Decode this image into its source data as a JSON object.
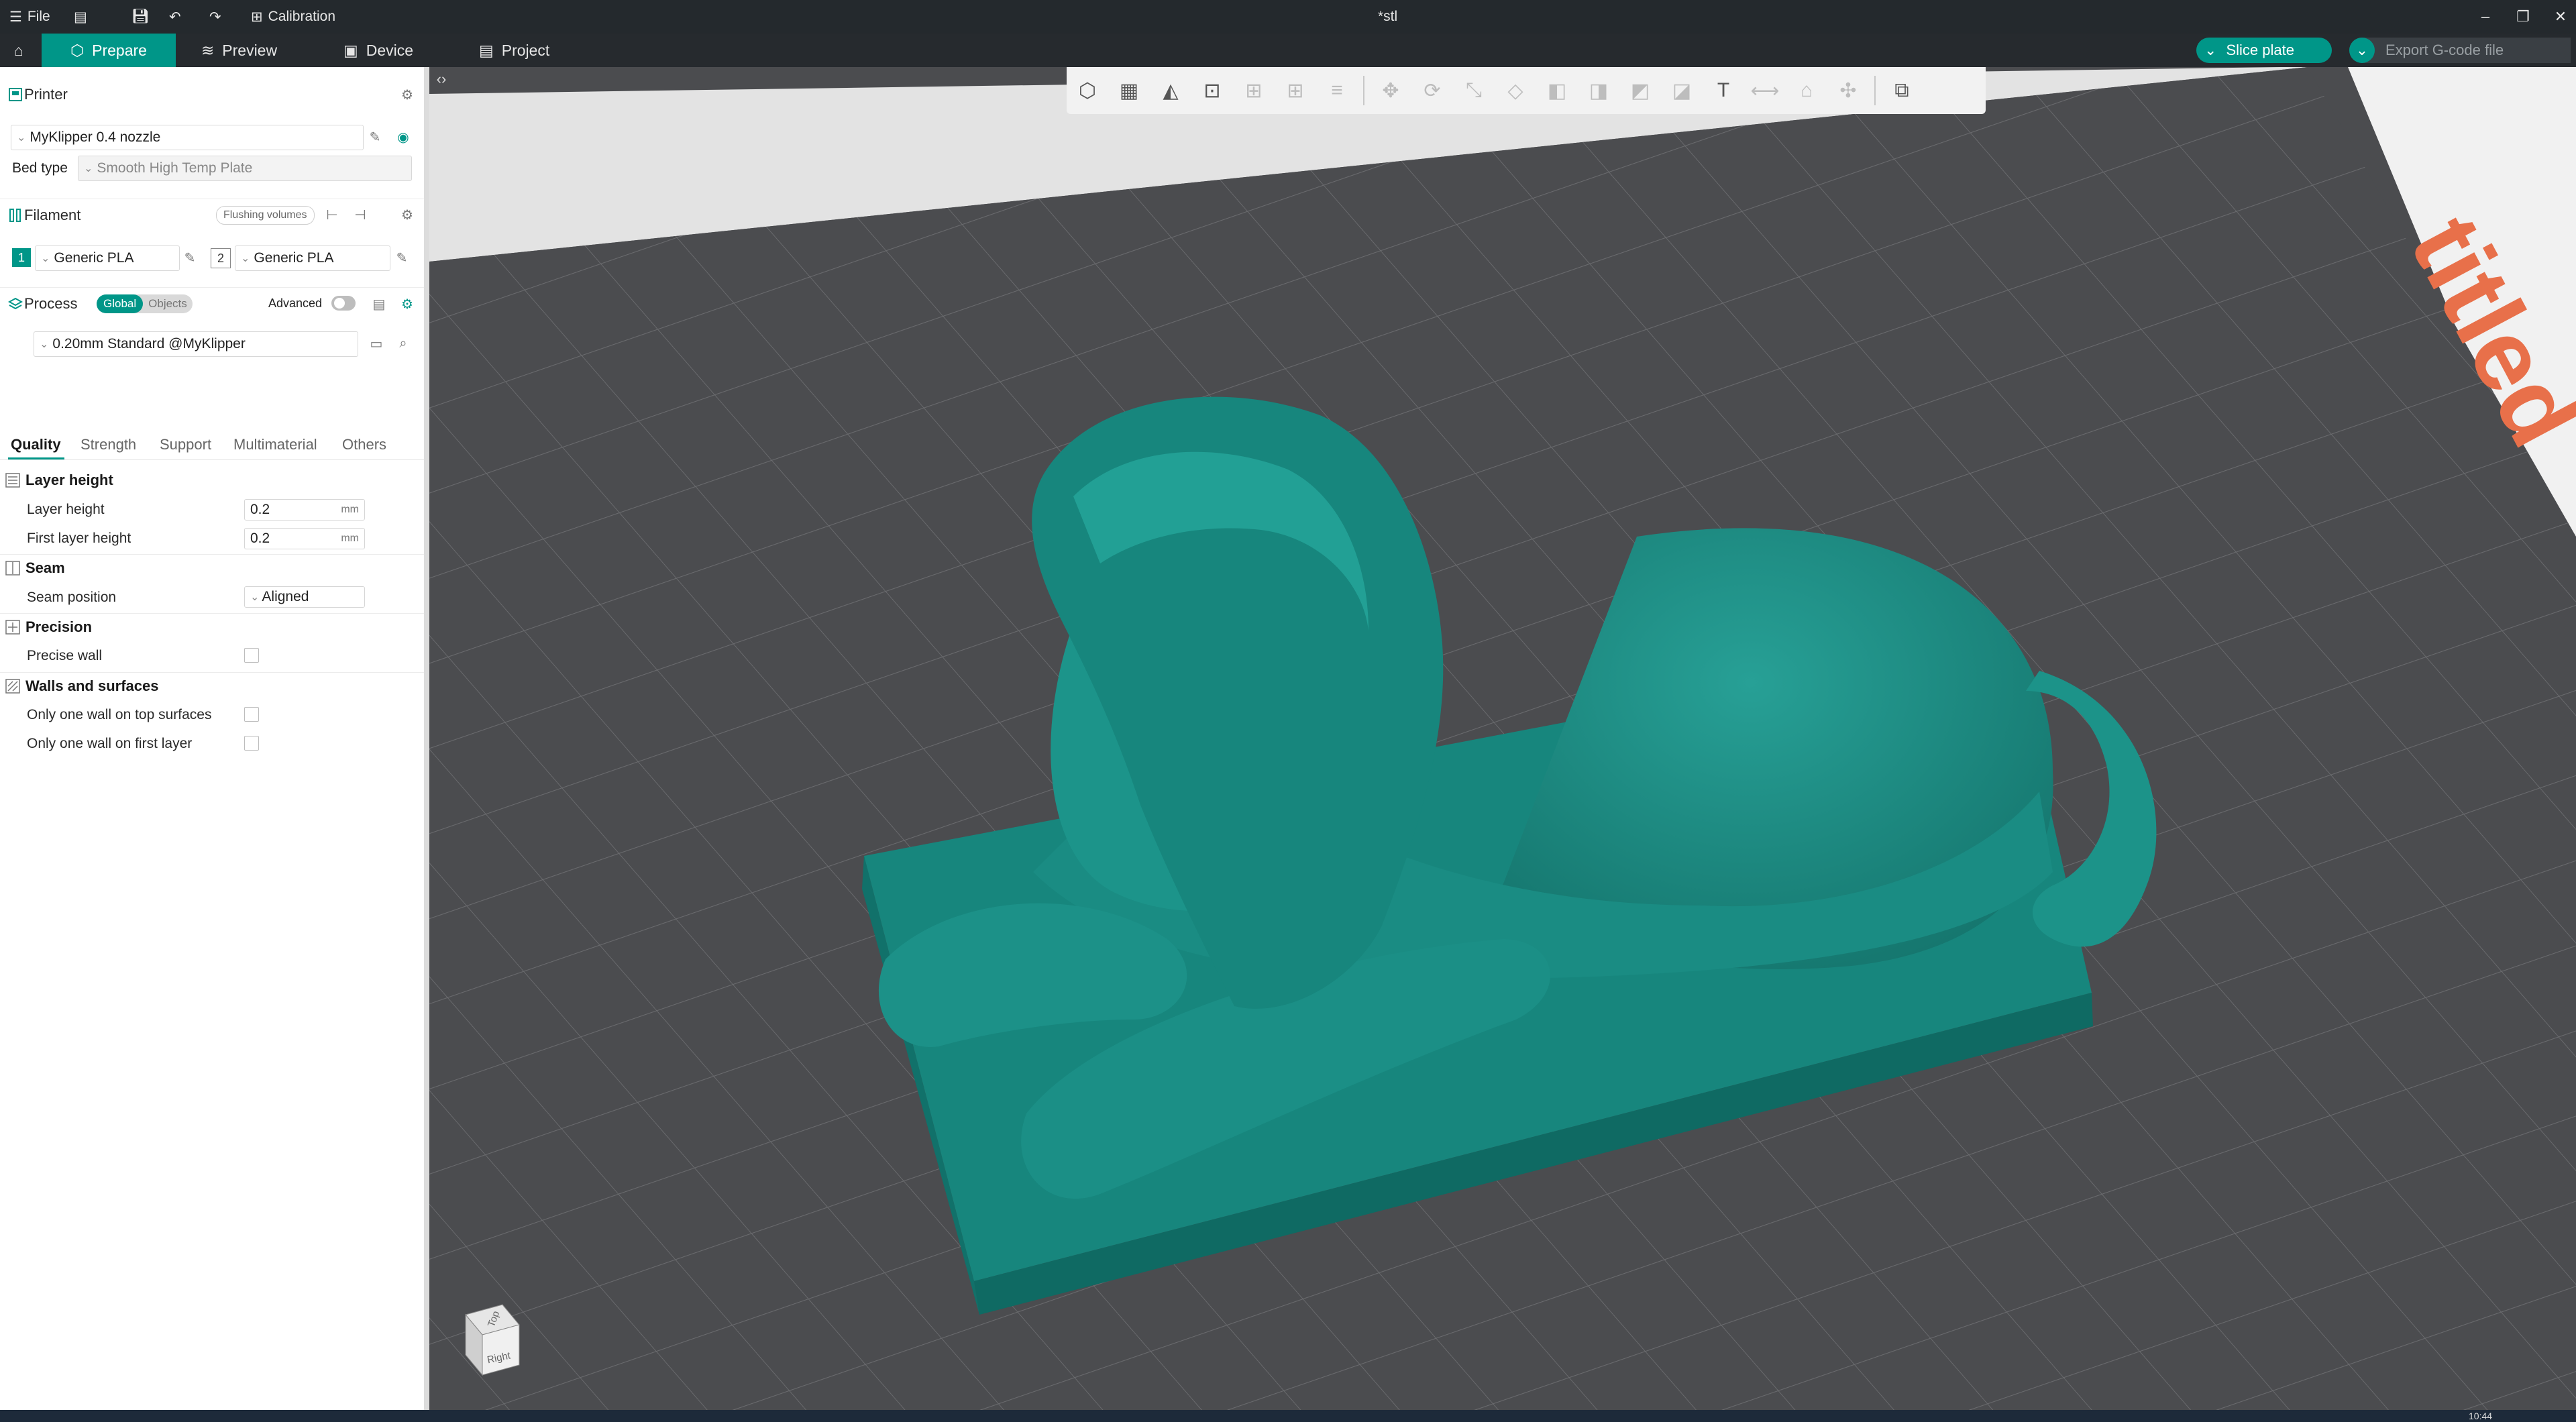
{
  "titlebar": {
    "file_label": "File",
    "calibration_label": "Calibration",
    "window_title": "*stl",
    "minimize": "–",
    "restore": "❐",
    "close": "✕"
  },
  "tabs": {
    "prepare": "Prepare",
    "preview": "Preview",
    "device": "Device",
    "project": "Project",
    "slice_plate": "Slice plate",
    "export_gcode": "Export G-code file"
  },
  "printer": {
    "section_title": "Printer",
    "selected": "MyKlipper 0.4 nozzle",
    "bed_type_label": "Bed type",
    "bed_type_value": "Smooth High Temp Plate"
  },
  "filament": {
    "section_title": "Filament",
    "flushing_button": "Flushing volumes",
    "slots": [
      {
        "index": "1",
        "name": "Generic PLA"
      },
      {
        "index": "2",
        "name": "Generic PLA"
      }
    ]
  },
  "process": {
    "section_title": "Process",
    "toggle_global": "Global",
    "toggle_objects": "Objects",
    "advanced_label": "Advanced",
    "preset": "0.20mm Standard @MyKlipper",
    "subtabs": [
      "Quality",
      "Strength",
      "Support",
      "Multimaterial",
      "Others"
    ],
    "active_subtab": "Quality"
  },
  "settings": {
    "layer_height_group": "Layer height",
    "layer_height_label": "Layer height",
    "layer_height_value": "0.2",
    "first_layer_height_label": "First layer height",
    "first_layer_height_value": "0.2",
    "unit_mm": "mm",
    "seam_group": "Seam",
    "seam_position_label": "Seam position",
    "seam_position_value": "Aligned",
    "precision_group": "Precision",
    "precise_wall_label": "Precise wall",
    "walls_group": "Walls and surfaces",
    "one_wall_top_label": "Only one wall on top surfaces",
    "one_wall_first_label": "Only one wall on first layer"
  },
  "viewport": {
    "plate_label": "titled",
    "cube_top": "Top",
    "cube_right": "Right"
  },
  "taskbar": {
    "clock": "10:44"
  },
  "colors": {
    "accent": "#009688",
    "model": "#1e8f86",
    "bed": "#4b4c4f",
    "plate_text": "#e8704a"
  }
}
